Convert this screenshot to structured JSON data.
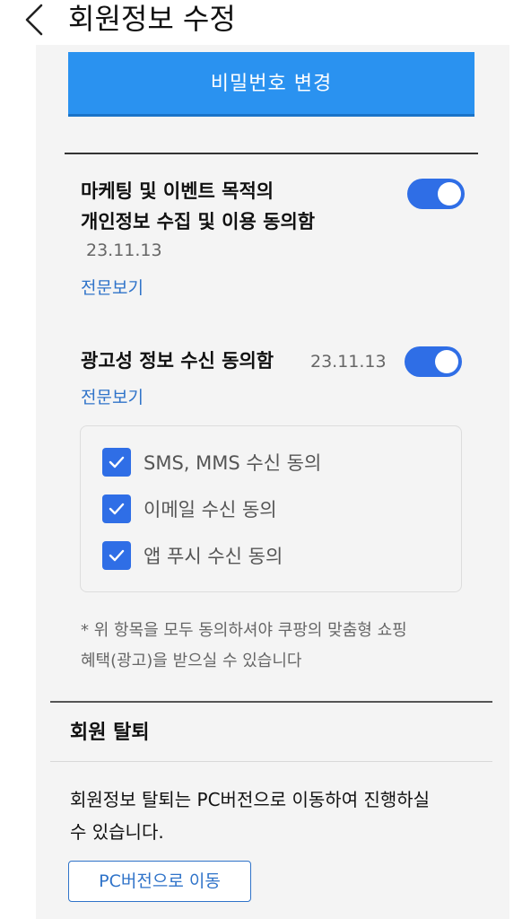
{
  "header": {
    "title": "회원정보 수정",
    "back_icon": "chevron-left-icon"
  },
  "password": {
    "button_label": "비밀번호 변경"
  },
  "marketing": {
    "title_line1": "마케팅 및 이벤트 목적의",
    "title_line2": "개인정보 수집 및 이용 동의함",
    "date": "23.11.13",
    "link": "전문보기",
    "toggle_on": true
  },
  "advertising": {
    "title": "광고성 정보 수신 동의함",
    "date": "23.11.13",
    "link": "전문보기",
    "toggle_on": true,
    "options": [
      {
        "label": "SMS, MMS 수신 동의",
        "checked": true
      },
      {
        "label": "이메일 수신 동의",
        "checked": true
      },
      {
        "label": "앱 푸시 수신 동의",
        "checked": true
      }
    ]
  },
  "note": {
    "line1": "* 위 항목을 모두 동의하셔야 쿠팡의 맞춤형 쇼핑",
    "line2": "혜택(광고)을 받으실 수 있습니다"
  },
  "withdraw": {
    "title": "회원 탈퇴",
    "desc_line1": "회원정보 탈퇴는 PC버전으로 이동하여 진행하실",
    "desc_line2": "수 있습니다.",
    "button_label": "PC버전으로 이동"
  },
  "colors": {
    "primary_button": "#2a92f0",
    "toggle_on": "#2f6ee6",
    "checkbox": "#2f6ee6",
    "link": "#2f73c9",
    "canvas": "#f4f4f4"
  }
}
